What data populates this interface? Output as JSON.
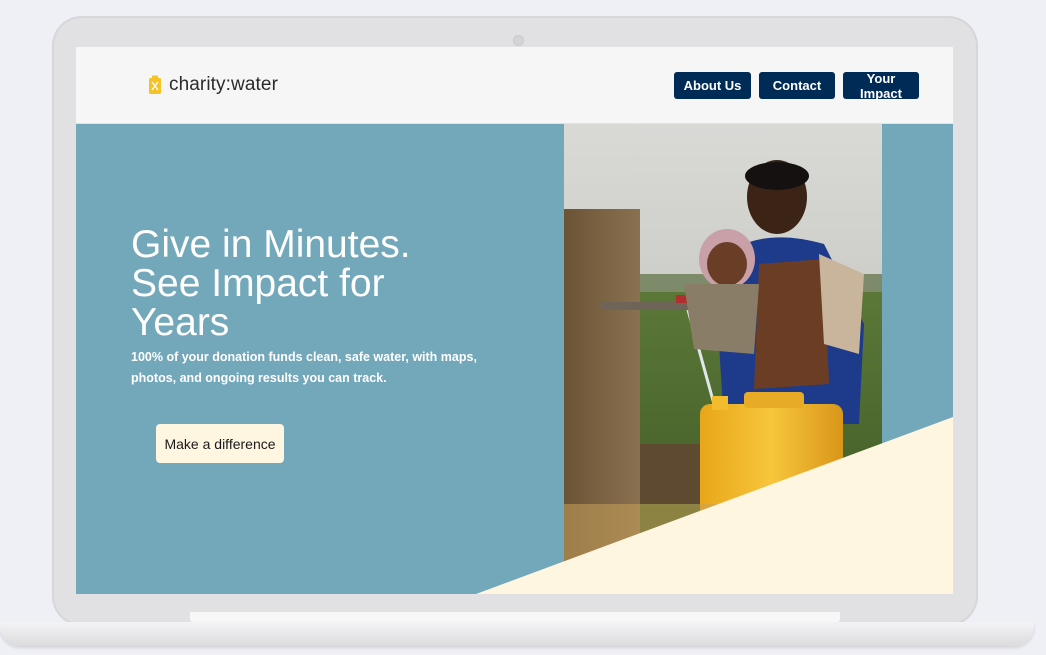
{
  "brand": {
    "name": "charity:water",
    "logo_color": "#f6c325"
  },
  "nav": {
    "items": [
      "About Us",
      "Contact",
      "Your Impact"
    ],
    "button_color": "#002b57"
  },
  "hero": {
    "headline": "Give in Minutes. See Impact for Years",
    "subtext": "100% of your donation funds clean, safe water, with maps, photos, and ongoing results you can track.",
    "cta_label": "Make a difference",
    "background_color": "#73a7ba",
    "accent_color": "#fff6e2"
  }
}
